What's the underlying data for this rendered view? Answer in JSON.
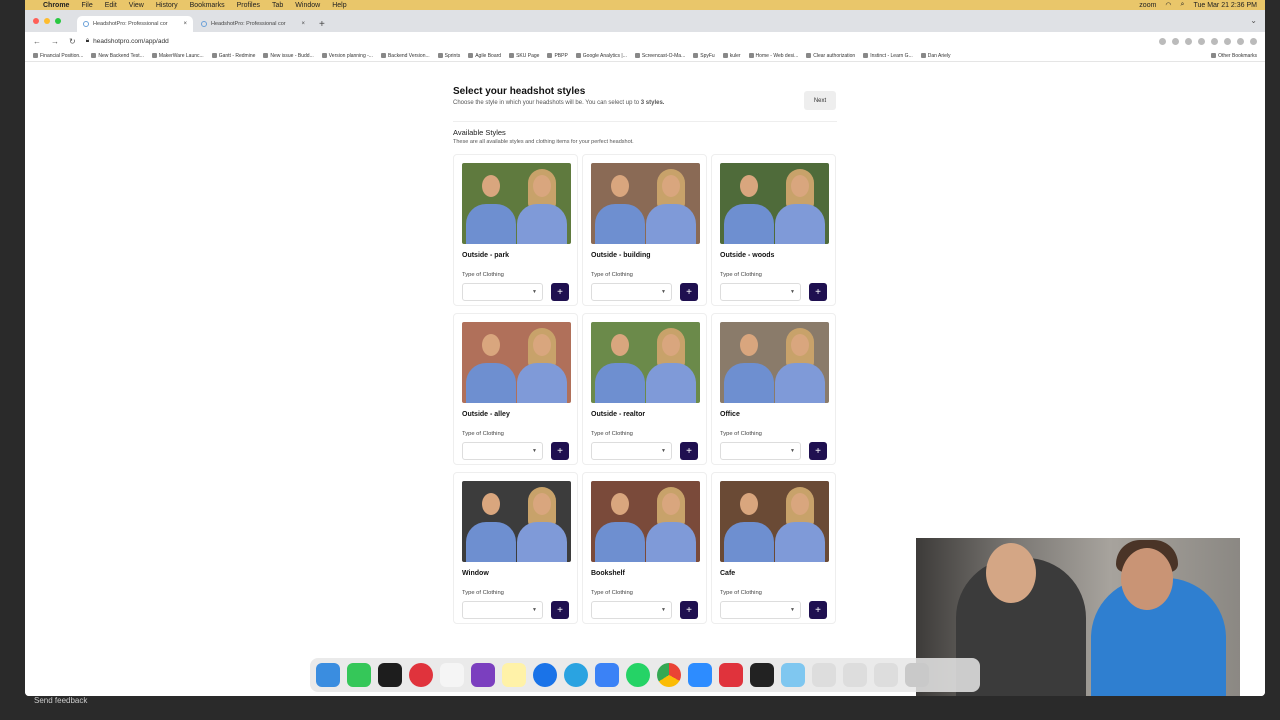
{
  "menubar": {
    "app": "Chrome",
    "items": [
      "File",
      "Edit",
      "View",
      "History",
      "Bookmarks",
      "Profiles",
      "Tab",
      "Window",
      "Help"
    ],
    "zoom": "zoom",
    "clock": "Tue Mar 21  2:36 PM"
  },
  "tabs": [
    {
      "title": "HeadshotPro: Professional cor"
    },
    {
      "title": "HeadshotPro: Professional cor"
    }
  ],
  "address": {
    "url": "headshotpro.com/app/add"
  },
  "bookmarks": [
    "Financial Position...",
    "New Backend Test...",
    "MakerWare Launc...",
    "Gantt - Redmine",
    "New issue - Budd...",
    "Version planning -...",
    "Backend Version...",
    "Sprints",
    "Agile Board",
    "SKU Page",
    "PBPP",
    "Google Analytics |...",
    "Screencast-O-Ma...",
    "SpyFu",
    "kuler",
    "Home - Web desi...",
    "Clear authorization",
    "Instinct - Learn G...",
    "Dan Ariely"
  ],
  "bookmarks_other": "Other Bookmarks",
  "header": {
    "title": "Select your headshot styles",
    "subtitle_pre": "Choose the style in which your headshots will be. You can select up to ",
    "subtitle_bold": "3 styles.",
    "next_label": "Next"
  },
  "available": {
    "title": "Available Styles",
    "subtitle": "These are all available styles and clothing items for your perfect headshot."
  },
  "clothing_label": "Type of Clothing",
  "add_label": "+",
  "select_arrow": "▼",
  "styles": [
    {
      "name": "Outside - park",
      "bg": "#5f7a3e"
    },
    {
      "name": "Outside - building",
      "bg": "#8a6a55"
    },
    {
      "name": "Outside - woods",
      "bg": "#4f6b3a"
    },
    {
      "name": "Outside - alley",
      "bg": "#b0705a"
    },
    {
      "name": "Outside - realtor",
      "bg": "#6b8a4a"
    },
    {
      "name": "Office",
      "bg": "#8a7b6a"
    },
    {
      "name": "Window",
      "bg": "#3c3c3c"
    },
    {
      "name": "Bookshelf",
      "bg": "#7a4a3a"
    },
    {
      "name": "Cafe",
      "bg": "#6a4a35"
    }
  ],
  "feedback": "Send feedback"
}
